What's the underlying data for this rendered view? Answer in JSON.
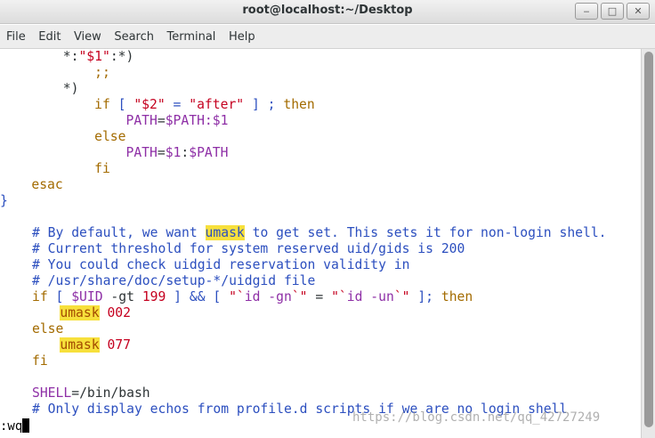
{
  "window": {
    "title": "root@localhost:~/Desktop",
    "minimize_glyph": "‒",
    "maximize_glyph": "□",
    "close_glyph": "✕"
  },
  "menu": [
    "File",
    "Edit",
    "View",
    "Search",
    "Terminal",
    "Help"
  ],
  "code": {
    "l1": [
      "        ",
      "*:",
      "\"$1\"",
      ":*)"
    ],
    "l2": [
      "            ",
      ";;"
    ],
    "l3": [
      "        ",
      "*)"
    ],
    "l4": [
      "            ",
      "if",
      " [ ",
      "\"$2\"",
      " = ",
      "\"after\"",
      " ] ; ",
      "then"
    ],
    "l5": [
      "                ",
      "PATH",
      "=",
      "$PATH",
      ":$1"
    ],
    "l6": [
      "            ",
      "else"
    ],
    "l7": [
      "                ",
      "PATH",
      "=",
      "$1",
      ":",
      "$PATH"
    ],
    "l8": [
      "            ",
      "fi"
    ],
    "l9": [
      "    ",
      "esac"
    ],
    "l10": [
      "}"
    ],
    "l11": [
      "# By default, we want ",
      "umask",
      " to get set. This sets it for non-login shell."
    ],
    "l12": [
      "# Current threshold for system reserved uid/gids is 200"
    ],
    "l13": [
      "# You could check uidgid reservation validity in"
    ],
    "l14": [
      "# /usr/share/doc/setup-*/uidgid file"
    ],
    "l15": [
      "if",
      " [ ",
      "$UID",
      " -gt ",
      "199",
      " ] && [ ",
      "\"`",
      "id -gn",
      "`\"",
      " = ",
      "\"`",
      "id -un",
      "`\"",
      " ]; ",
      "then"
    ],
    "l16": [
      "    ",
      "umask",
      " ",
      "002"
    ],
    "l17": [
      "else"
    ],
    "l18": [
      "    ",
      "umask",
      " ",
      "077"
    ],
    "l19": [
      "fi"
    ],
    "l20": [
      "SHELL",
      "=",
      "/bin/bash"
    ],
    "l21": [
      "# Only display echos from profile.d scripts if we are no login shell"
    ]
  },
  "command_line": ":wq",
  "watermark": "https://blog.csdn.net/qq_42727249",
  "colors": {
    "comment": "#2c4fbf",
    "keyword": "#a36b00",
    "variable": "#8e2fa6",
    "string": "#c5001f",
    "highlight": "#f7e03c"
  }
}
